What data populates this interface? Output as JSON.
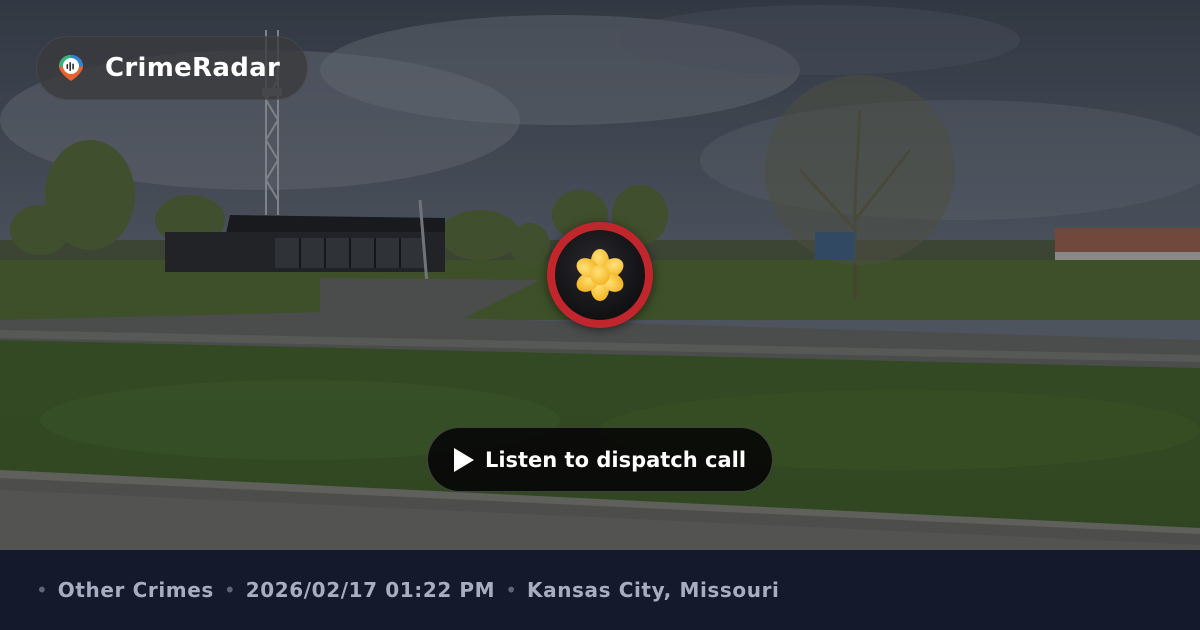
{
  "brand": {
    "name": "CrimeRadar",
    "logo_icon": "map-pin-audio-icon"
  },
  "marker": {
    "icon": "asterisk-incident-icon",
    "ring_color": "#c1262c",
    "icon_color": "#f7c531"
  },
  "listen_button": {
    "label": "Listen to dispatch call",
    "icon": "play-icon"
  },
  "incident": {
    "category": "Other Crimes",
    "datetime": "2026/02/17 01:22 PM",
    "location": "Kansas City, Missouri"
  },
  "colors": {
    "footer_bg": "#141a2b",
    "footer_text": "#a8aec0",
    "accent_red": "#c1262c"
  }
}
